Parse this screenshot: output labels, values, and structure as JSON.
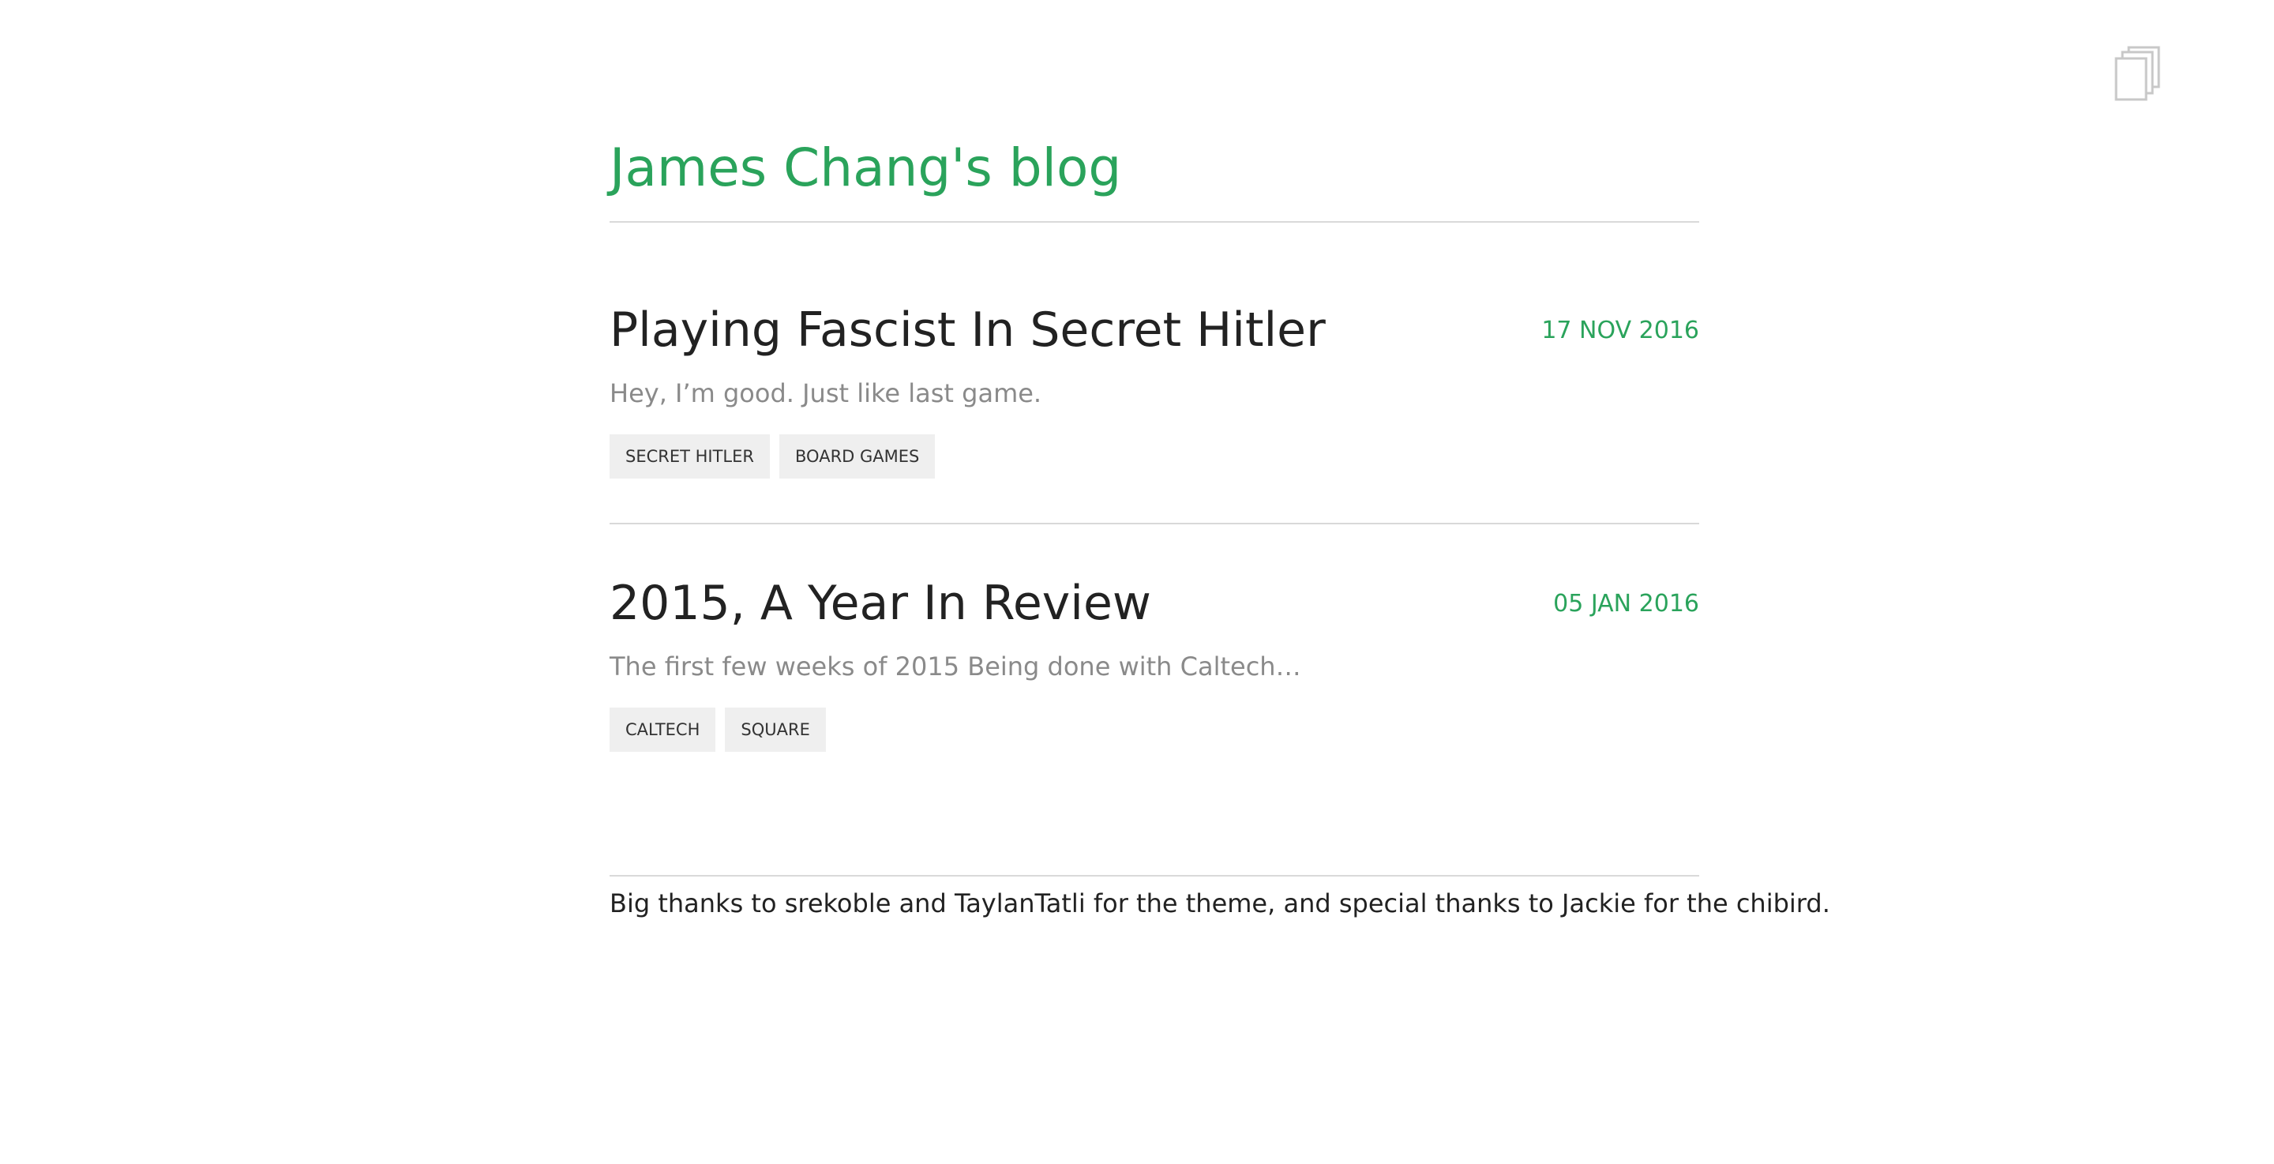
{
  "header": {
    "blog_title": "James Chang's blog"
  },
  "icons": {
    "top_right": "copy-pages-icon"
  },
  "posts": [
    {
      "title": "Playing Fascist In Secret Hitler",
      "date": "17 NOV 2016",
      "excerpt": "Hey, I’m good. Just like last game.",
      "tags": [
        "SECRET HITLER",
        "BOARD GAMES"
      ]
    },
    {
      "title": "2015, A Year In Review",
      "date": "05 JAN 2016",
      "excerpt": "The first few weeks of 2015 Being done with Caltech…",
      "tags": [
        "CALTECH",
        "SQUARE"
      ]
    }
  ],
  "footer": {
    "text": "Big thanks to srekoble and TaylanTatli for the theme, and special thanks to Jackie for the chibird."
  },
  "colors": {
    "accent": "#2aa35b",
    "title_text": "#222222",
    "excerpt_text": "#8a8a8a",
    "tag_background": "#efefef",
    "rule": "#d9d9d9"
  }
}
